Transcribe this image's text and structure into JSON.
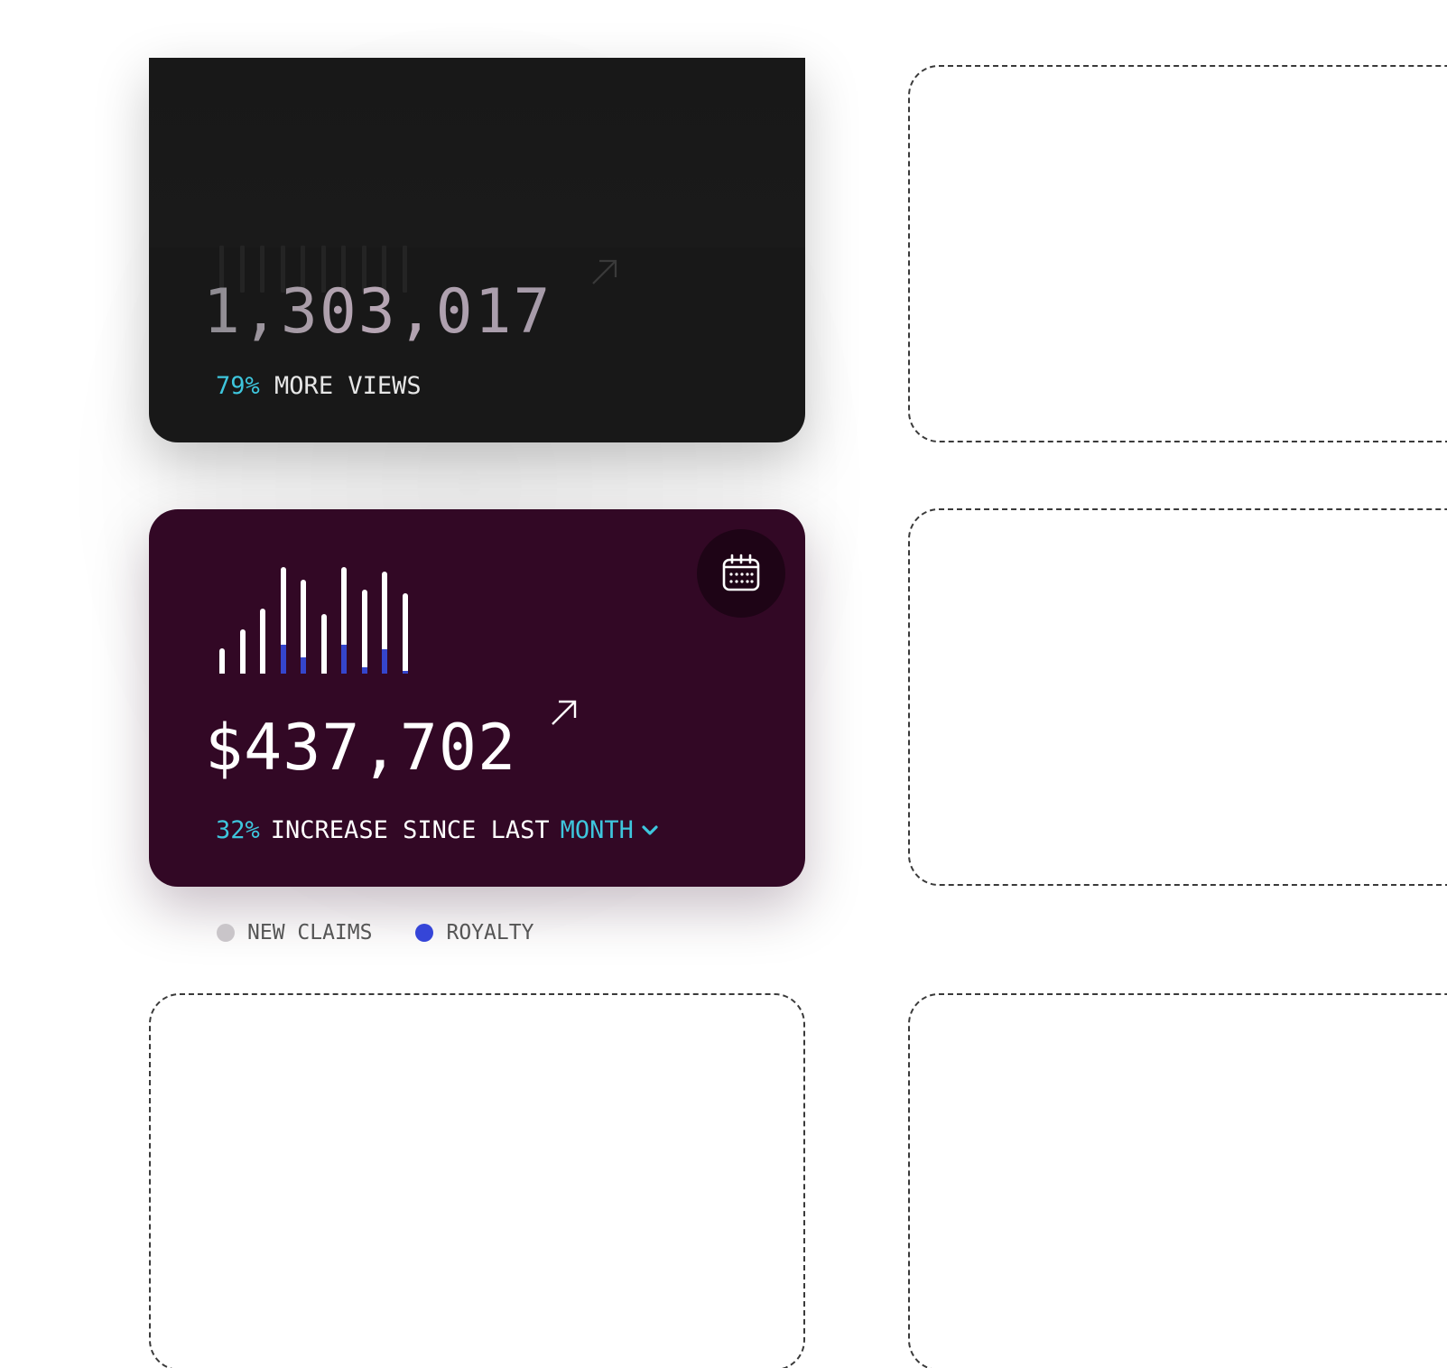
{
  "views_card": {
    "value": "1,303,017",
    "change_percent": "79%",
    "change_label": "MORE VIEWS",
    "trend_icon": "arrow-up-right-icon"
  },
  "revenue_card": {
    "value": "$437,702",
    "change_percent": "32%",
    "change_label": "INCREASE SINCE LAST",
    "period": "MONTH",
    "period_icon": "chevron-down-icon",
    "trend_icon": "arrow-up-right-icon",
    "calendar_icon": "calendar-icon"
  },
  "chart_data": {
    "type": "bar",
    "series": [
      {
        "name": "NEW CLAIMS",
        "values": [
          24,
          42,
          62,
          102,
          90,
          57,
          102,
          80,
          98,
          77
        ]
      },
      {
        "name": "ROYALTY",
        "values": [
          0,
          0,
          0,
          28,
          16,
          0,
          28,
          6,
          23,
          3
        ]
      }
    ]
  },
  "legend": [
    {
      "label": "NEW CLAIMS",
      "color": "#c9c5c9"
    },
    {
      "label": "ROYALTY",
      "color": "#3545d8"
    }
  ],
  "colors": {
    "accent": "#3ec6dd",
    "views_card_bg": "#181818",
    "revenue_card_bg": "#320825",
    "bar": "#ffffff",
    "royalty": "#3545cc"
  }
}
